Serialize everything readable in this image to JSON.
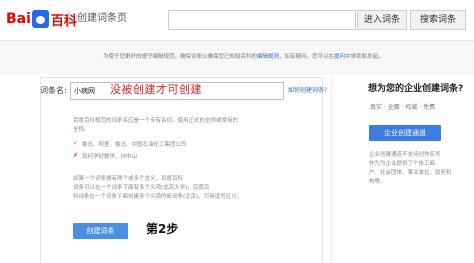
{
  "header": {
    "logo_bai": "Bai",
    "logo_du": "du",
    "logo_baike": "百科",
    "page_title": "创建词条页",
    "search_placeholder": "",
    "enter_button": "进入词条",
    "search_button": "搜索词条"
  },
  "notice": {
    "part1": "为使于您更好的遵守编辑规范，确保词条公确保您已知晓百科的",
    "link1": "编辑规则",
    "part2": "，如有疑问，您可以在",
    "link2": "提问",
    "part3": "中求助和发起。"
  },
  "form": {
    "label": "词条名:",
    "entry_value": "小病网",
    "red_note": "没被创建才可创建",
    "how_link": "如何创建词条?",
    "desc1": "百度百科规范的词条名应是一个专有名词，使用正式的全称或常用的",
    "desc2": "全称。",
    "ok_example": "鲁迅、阿里、鲁迅、中国石油化工集团公司",
    "bad_example": "如何学好数学、孙中山",
    "extra1": "如果一个词条拥有两个或多个含义，百度百科",
    "extra2": "词条可以在一个词条下面有多个义项(北京大学)，百度百",
    "extra3": "科词条在一个词条下面创建多个义项的新词条(北京)，可用逗号区分。",
    "create_button": "创建词条",
    "step_label": "第2步"
  },
  "promo": {
    "title": "想为您的企业创建词条?",
    "sub": "真实 · 全面 · 权威 · 免费",
    "button": "企业创建通道",
    "desc1": "企业创建通道不支持创作实写",
    "desc2": "作为为企业提供了个体工商",
    "desc3": "户、社会团体、事业单位、政府机",
    "desc4": "构等。",
    "more": ""
  }
}
